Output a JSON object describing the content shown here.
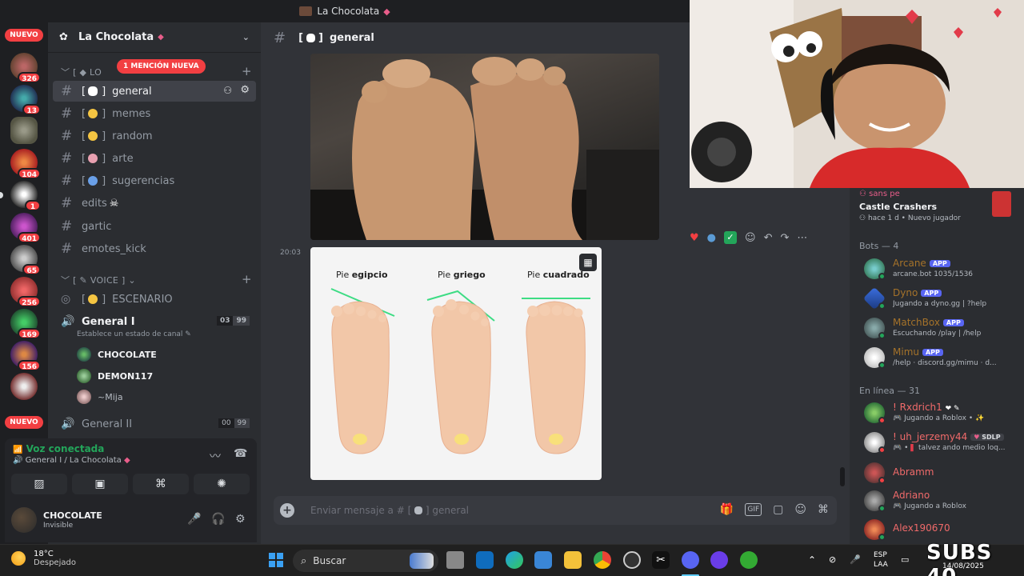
{
  "window": {
    "title": "La Chocolata"
  },
  "rail": {
    "badges": [
      "326",
      "13",
      "104",
      "1",
      "401",
      "65",
      "256",
      "169",
      "156"
    ],
    "new_top": "NUEVO",
    "new_bottom": "NUEVO"
  },
  "server": {
    "name": "La Chocolata"
  },
  "sidebar": {
    "mention_banner": "1 MENCIÓN NUEVA",
    "category_top": "LO",
    "channels": [
      {
        "name": "general",
        "prefix": "[",
        "suffix": "]"
      },
      {
        "name": "memes"
      },
      {
        "name": "random"
      },
      {
        "name": "arte"
      },
      {
        "name": "sugerencias"
      },
      {
        "name": "edits"
      },
      {
        "name": "gartic"
      },
      {
        "name": "emotes_kick"
      }
    ],
    "voice_category": "VOICE",
    "stage_channel": "ESCENARIO",
    "voice_channel_1": {
      "name": "General I",
      "count_a": "03",
      "count_b": "99",
      "status": "Establece un estado de canal"
    },
    "voice_users": [
      "CHOCOLATE",
      "DEMON117",
      "~Mija"
    ],
    "voice_channel_2": {
      "name": "General II",
      "count_a": "00",
      "count_b": "99"
    }
  },
  "voice_panel": {
    "title": "Voz conectada",
    "subtitle": "General I / La Chocolata"
  },
  "user_panel": {
    "name": "CHOCOLATE",
    "status": "Invisible"
  },
  "chat": {
    "channel": "general",
    "timestamp": "20:03",
    "diagram": {
      "label_prefix": "Pie",
      "labels": [
        "egipcio",
        "griego",
        "cuadrado"
      ]
    },
    "composer_placeholder": "Enviar mensaje a #",
    "composer_channel": "general"
  },
  "members": {
    "top_item": {
      "sub1": "sans pe",
      "name": "Castle Crashers",
      "sub2": "hace 1 d",
      "sub3": "Nuevo jugador"
    },
    "bots_header": "Bots — 4",
    "bots": [
      {
        "name": "Arcane",
        "tag": "APP",
        "sub": "arcane.bot 1035/1536",
        "color": "#a5732a"
      },
      {
        "name": "Dyno",
        "tag": "APP",
        "sub": "Jugando a dyno.gg | ?help",
        "color": "#a5732a"
      },
      {
        "name": "MatchBox",
        "tag": "APP",
        "sub": "Escuchando /play | /help",
        "color": "#a5732a"
      },
      {
        "name": "Mimu",
        "tag": "APP",
        "sub": "/help · discord.gg/mimu · d...",
        "color": "#a5732a"
      }
    ],
    "online_header": "En línea — 31",
    "online": [
      {
        "name": "! Rxdrich1",
        "sub": "Jugando a Roblox",
        "color": "#f06a6a"
      },
      {
        "name": "! uh_jerzemy44",
        "tag": "SDLP",
        "sub": "talvez ando medio loq...",
        "color": "#f06a6a"
      },
      {
        "name": "Abramm",
        "sub": "",
        "color": "#f06a6a"
      },
      {
        "name": "Adriano",
        "sub": "Jugando a Roblox",
        "color": "#f06a6a"
      },
      {
        "name": "Alex190670",
        "sub": "",
        "color": "#f06a6a"
      }
    ]
  },
  "taskbar": {
    "temp": "18°C",
    "weather": "Despejado",
    "search": "Buscar",
    "lang1": "ESP",
    "lang2": "LAA",
    "date": "14/08/2025"
  },
  "overlay": {
    "subs": "SUBS 40"
  },
  "colors": {
    "accent": "#5865f2",
    "danger": "#f23f42",
    "online": "#23a55a"
  }
}
